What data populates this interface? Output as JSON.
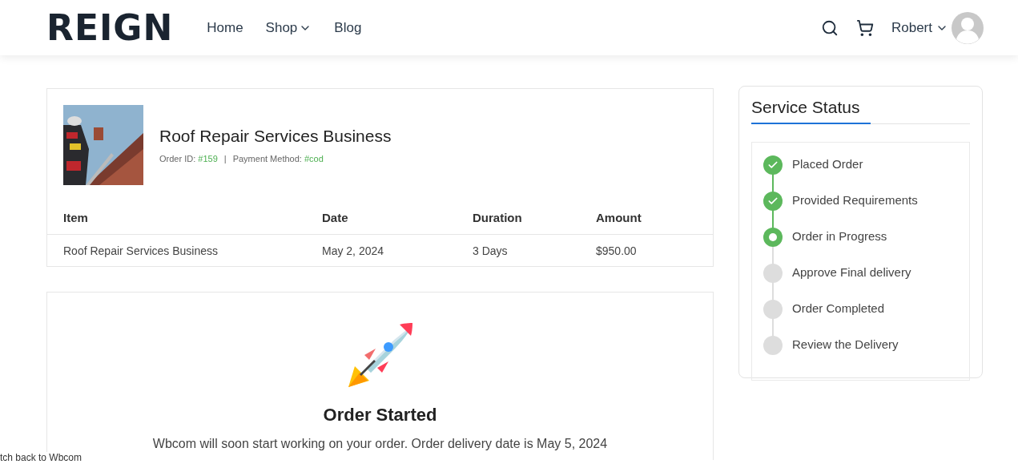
{
  "header": {
    "logo": "REIGN",
    "nav": [
      {
        "label": "Home",
        "dropdown": false
      },
      {
        "label": "Shop",
        "dropdown": true
      },
      {
        "label": "Blog",
        "dropdown": false
      }
    ],
    "user": "Robert"
  },
  "order": {
    "title": "Roof Repair Services Business",
    "order_id_label": "Order ID:",
    "order_id": "#159",
    "separator": "|",
    "payment_label": "Payment Method:",
    "payment": "#cod",
    "table": {
      "columns": [
        "Item",
        "Date",
        "Duration",
        "Amount"
      ],
      "rows": [
        [
          "Roof Repair Services Business",
          "May 2, 2024",
          "3 Days",
          "$950.00"
        ]
      ]
    }
  },
  "status_card": {
    "title": "Order Started",
    "message": "Wbcom will soon start working on your order. Order delivery date is May 5, 2024"
  },
  "service_status": {
    "title": "Service Status",
    "steps": [
      {
        "label": "Placed Order",
        "completed": true,
        "current": false
      },
      {
        "label": "Provided Requirements",
        "completed": true,
        "current": false
      },
      {
        "label": "Order in Progress",
        "completed": false,
        "current": true
      },
      {
        "label": "Approve Final delivery",
        "completed": false,
        "current": false
      },
      {
        "label": "Order Completed",
        "completed": false,
        "current": false
      },
      {
        "label": "Review the Delivery",
        "completed": false,
        "current": false
      }
    ]
  },
  "switch_link": "tch back to Wbcom"
}
